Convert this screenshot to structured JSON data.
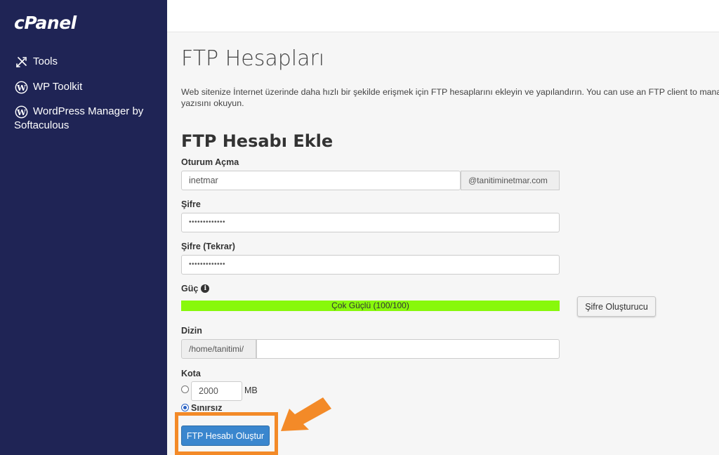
{
  "sidebar": {
    "logo": "cPanel",
    "items": [
      {
        "label": "Tools",
        "icon": "tools-icon"
      },
      {
        "label": "WP Toolkit",
        "icon": "wordpress-icon"
      },
      {
        "label": "WordPress Manager by Softaculous",
        "icon": "wordpress-icon"
      }
    ]
  },
  "page": {
    "title": "FTP Hesapları",
    "description_line1": "Web sitenize İnternet üzerinde daha hızlı bir şekilde erişmek için FTP hesaplarını ekleyin ve yapılandırın. You can use an FTP client to manage",
    "description_line2": "yazısını okuyun."
  },
  "form": {
    "section_title": "FTP Hesabı Ekle",
    "login_label": "Oturum Açma",
    "login_value": "inetmar",
    "login_domain": "@tanitiminetmar.com",
    "password_label": "Şifre",
    "password_value": "•••••••••••••",
    "password_repeat_label": "Şifre (Tekrar)",
    "password_repeat_value": "•••••••••••••",
    "strength_label": "Güç",
    "strength_text": "Çok Güçlü (100/100)",
    "strength_value": 100,
    "generator_button": "Şifre Oluşturucu",
    "directory_label": "Dizin",
    "directory_prefix": "/home/tanitimi/",
    "directory_value": "",
    "quota_label": "Kota",
    "quota_value": "2000",
    "quota_unit": "MB",
    "unlimited_label": "Sınırsız",
    "unlimited_selected": true,
    "submit_button": "FTP Hesabı Oluştur"
  },
  "colors": {
    "sidebar_bg": "#1f2455",
    "strength_bar": "#88f80b",
    "primary_button": "#3a86ce",
    "highlight": "#f38a28"
  }
}
